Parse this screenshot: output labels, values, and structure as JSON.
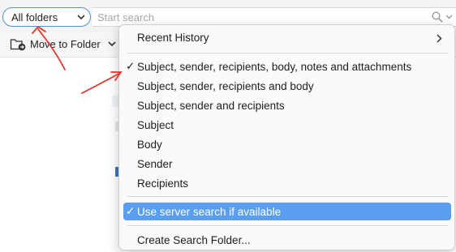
{
  "search": {
    "scope_value": "All folders",
    "placeholder": "Start search"
  },
  "toolbar": {
    "move_label": "Move to Folder"
  },
  "menu": {
    "recent_history": "Recent History",
    "options": [
      "Subject, sender, recipients, body, notes and attachments",
      "Subject, sender, recipients and body",
      "Subject, sender and recipients",
      "Subject",
      "Body",
      "Sender",
      "Recipients"
    ],
    "selected_option_index": 0,
    "server_search": "Use server search if available",
    "server_search_checked": true,
    "create_search_folder": "Create Search Folder...",
    "checkmark": "✓"
  },
  "colors": {
    "accent": "#4a93d9",
    "highlight": "#5a9ef0",
    "annotation": "#e0362c"
  }
}
